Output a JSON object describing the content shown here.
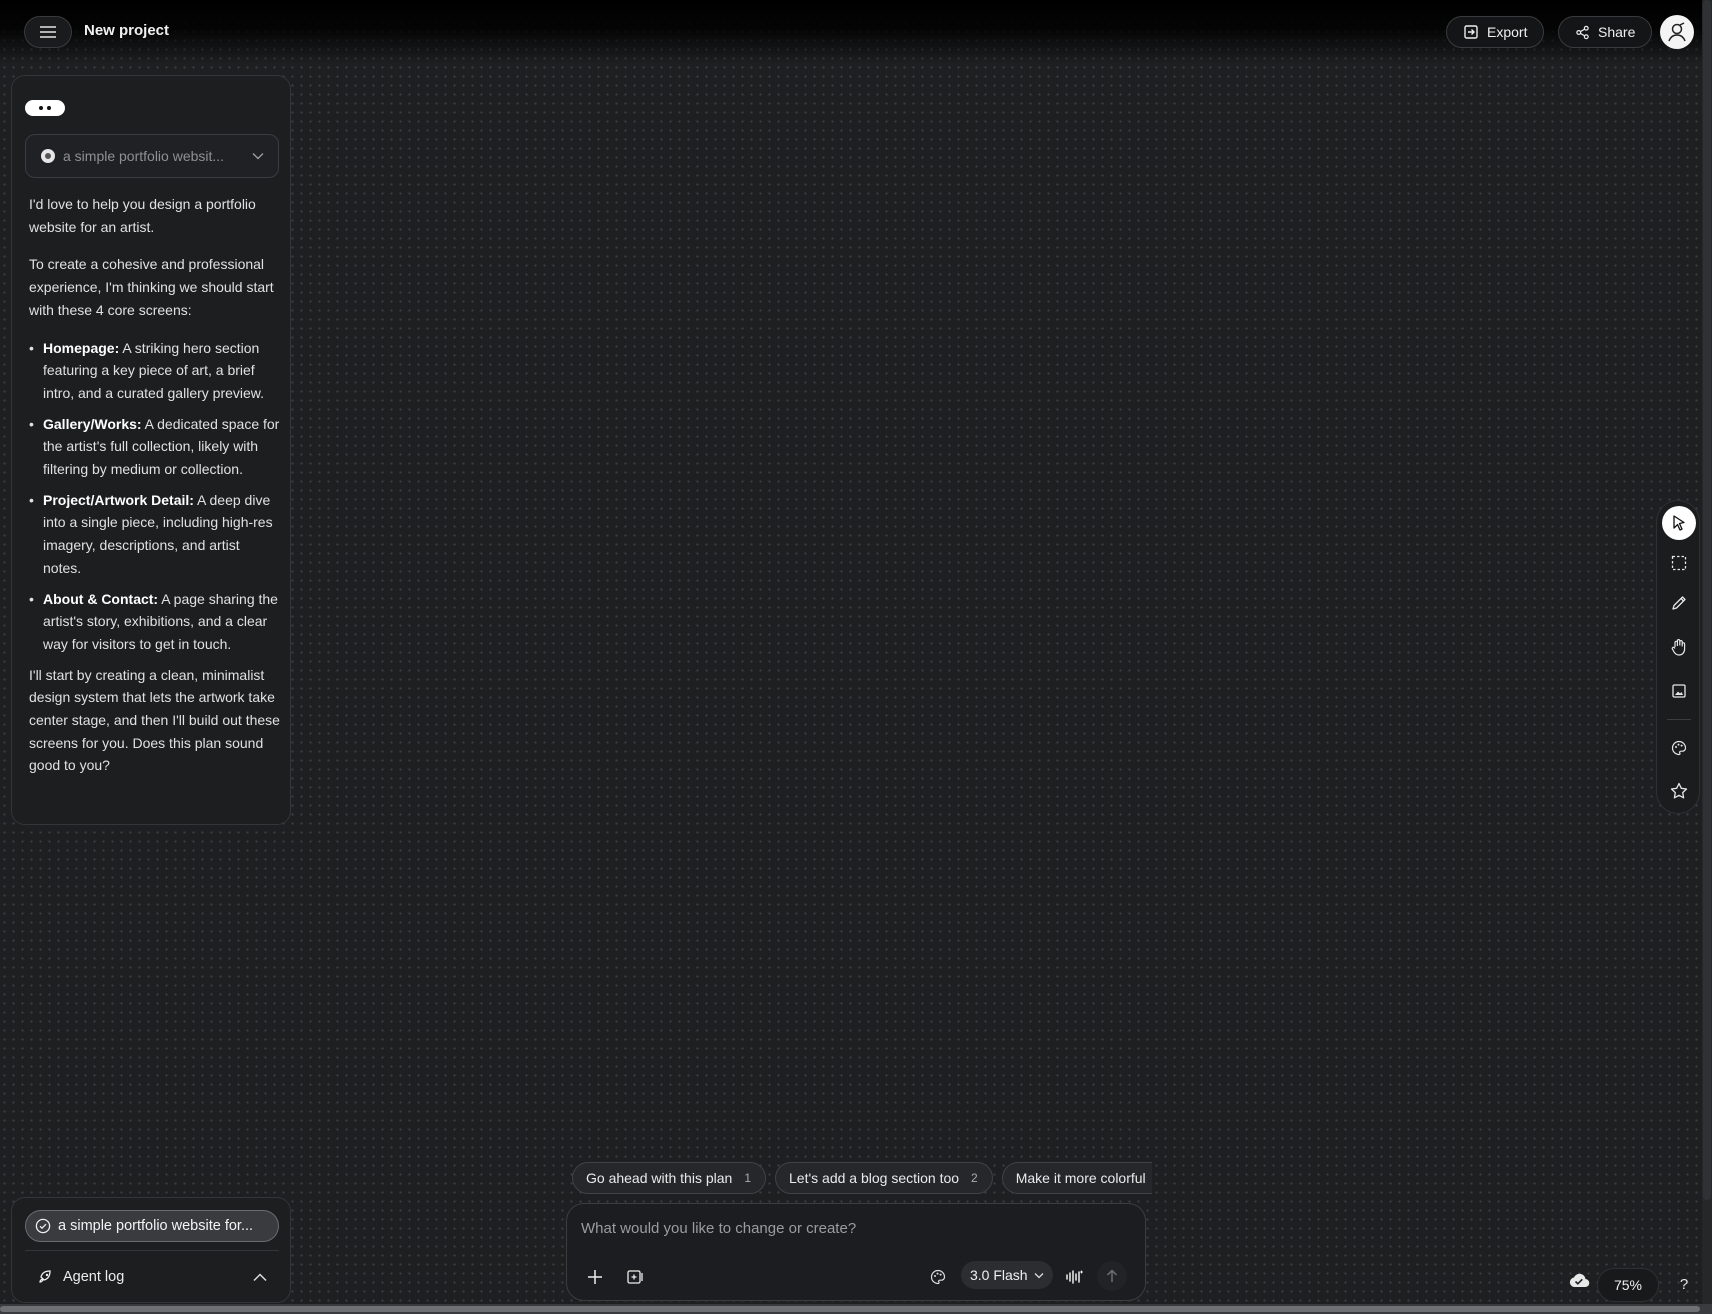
{
  "header": {
    "title": "New project",
    "export_label": "Export",
    "share_label": "Share"
  },
  "chat": {
    "context_label": "a simple portfolio websit...",
    "intro": "I'd love to help you design a portfolio website for an artist.",
    "plan_intro": "To create a cohesive and professional experience, I'm thinking we should start with these 4 core screens:",
    "screens": [
      {
        "title": "Homepage:",
        "desc": " A striking hero section featuring a key piece of art, a brief intro, and a curated gallery preview."
      },
      {
        "title": "Gallery/Works:",
        "desc": " A dedicated space for the artist's full collection, likely with filtering by medium or collection."
      },
      {
        "title": "Project/Artwork Detail:",
        "desc": " A deep dive into a single piece, including high-res imagery, descriptions, and artist notes."
      },
      {
        "title": "About & Contact:",
        "desc": " A page sharing the artist's story, exhibitions, and a clear way for visitors to get in touch."
      }
    ],
    "closing": "I'll start by creating a clean, minimalist design system that lets the artwork take center stage, and then I'll build out these screens for you. Does this plan sound good to you?"
  },
  "tasks": {
    "current_task": "a simple portfolio website for...",
    "agent_log_label": "Agent log"
  },
  "suggestions": [
    {
      "label": "Go ahead with this plan",
      "num": "1"
    },
    {
      "label": "Let's add a blog section too",
      "num": "2"
    },
    {
      "label": "Make it more colorful"
    }
  ],
  "composer": {
    "placeholder": "What would you like to change or create?",
    "model": "3.0 Flash"
  },
  "toolbar": {
    "tools": [
      "select-tool",
      "marquee-tool",
      "pencil-tool",
      "hand-tool",
      "image-tool",
      "palette-tool",
      "star-tool"
    ],
    "active": "select-tool"
  },
  "footer": {
    "zoom": "75%",
    "help": "?"
  }
}
